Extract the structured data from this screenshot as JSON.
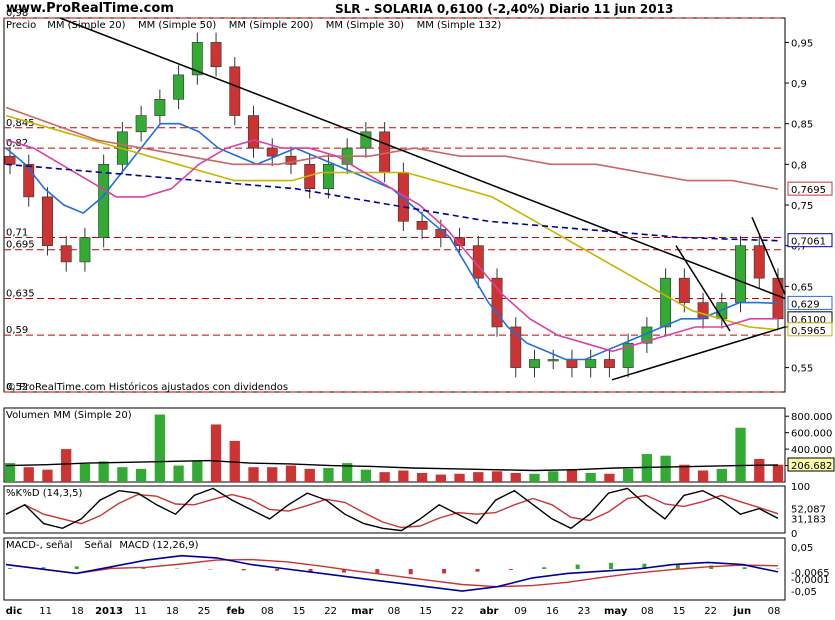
{
  "header": {
    "brand": "www.ProRealTime.com",
    "title": "SLR - SOLARIA    0,6100 (-2,40%)   Diario  11 jun 2013"
  },
  "colors": {
    "up": "#33aa33",
    "down": "#cc3333",
    "ma20": "#1f6fe0",
    "ma50": "#c8b400",
    "ma200": "#cc6666",
    "ma30": "#e040a0",
    "ma132": "#000099",
    "trend": "#000000",
    "hline": "#cc0000"
  },
  "price_panel": {
    "legend": [
      {
        "text": "Precio",
        "color": "#000000"
      },
      {
        "text": "MM (Simple 20)",
        "color": "#1f6fe0"
      },
      {
        "text": "MM (Simple 50)",
        "color": "#c8b400"
      },
      {
        "text": "MM (Simple 200)",
        "color": "#cc3333"
      },
      {
        "text": "MM (Simple 30)",
        "color": "#e040a0"
      },
      {
        "text": "MM (Simple 132)",
        "color": "#000099"
      }
    ],
    "footer": "© ProRealTime.com  Históricos ajustados con dividendos",
    "right_ticks": [
      "0,95",
      "0,9",
      "0,85",
      "0,8",
      "0,75",
      "0,7",
      "0,65",
      "0,6",
      "0,55"
    ],
    "right_badges": [
      {
        "text": "0,7695",
        "value": 0.7695,
        "color": "#cc3333"
      },
      {
        "text": "0,7061",
        "value": 0.7061,
        "color": "#000099"
      },
      {
        "text": "0,629",
        "value": 0.629,
        "color": "#1f6fe0"
      },
      {
        "text": "0,6100",
        "value": 0.61,
        "color": "#000000"
      },
      {
        "text": "0,5965",
        "value": 0.5965,
        "color": "#c8b400"
      }
    ],
    "hlines": [
      {
        "text": "0,98",
        "value": 0.98
      },
      {
        "text": "0,845",
        "value": 0.845
      },
      {
        "text": "0,82",
        "value": 0.82
      },
      {
        "text": "0,71",
        "value": 0.71
      },
      {
        "text": "0,695",
        "value": 0.695
      },
      {
        "text": "0,635",
        "value": 0.635
      },
      {
        "text": "0,59",
        "value": 0.59
      },
      {
        "text": "0,52",
        "value": 0.52
      }
    ]
  },
  "volume_panel": {
    "legend": [
      {
        "text": "Volumen",
        "color": "#cc3333"
      },
      {
        "text": "MM (Simple 20)",
        "color": "#000000"
      }
    ],
    "right_ticks": [
      "800.000",
      "600.000",
      "400.000",
      "200.000"
    ],
    "badge": "206.682"
  },
  "stoch_panel": {
    "legend": [
      {
        "text": "%K",
        "color": "#000000"
      },
      {
        "text": "%D (14,3,5)",
        "color": "#cc3333"
      }
    ],
    "right_ticks": [
      "100",
      "0"
    ],
    "badges": [
      "52,087",
      "31,183"
    ]
  },
  "macd_panel": {
    "legend": [
      {
        "text": "MACD-, señal",
        "color": "#cc3333"
      },
      {
        "text": "Señal",
        "color": "#cc3333"
      },
      {
        "text": "MACD (12,26,9)",
        "color": "#000099"
      }
    ],
    "right_ticks": [
      "0,05",
      "-0,05"
    ],
    "badges": [
      "-0,0065",
      "-0,0001"
    ]
  },
  "x_axis": [
    "dic",
    "11",
    "18",
    "2013",
    "11",
    "18",
    "25",
    "feb",
    "08",
    "15",
    "22",
    "mar",
    "08",
    "15",
    "22",
    "abr",
    "09",
    "16",
    "23",
    "may",
    "08",
    "15",
    "22",
    "jun",
    "08"
  ],
  "chart_data": {
    "type": "candlestick",
    "title": "SLR - SOLARIA 0,6100 (-2,40%) Diario 11 jun 2013",
    "ylabel": "",
    "ylim": [
      0.52,
      0.98
    ],
    "x_range": [
      "dic 2012",
      "11 jun 2013"
    ],
    "series": [
      {
        "name": "Precio",
        "close": [
          0.8,
          0.76,
          0.7,
          0.68,
          0.71,
          0.8,
          0.84,
          0.86,
          0.88,
          0.91,
          0.95,
          0.92,
          0.86,
          0.82,
          0.81,
          0.8,
          0.77,
          0.8,
          0.82,
          0.84,
          0.79,
          0.73,
          0.72,
          0.71,
          0.7,
          0.66,
          0.6,
          0.55,
          0.56,
          0.56,
          0.55,
          0.56,
          0.55,
          0.58,
          0.6,
          0.66,
          0.63,
          0.61,
          0.63,
          0.7,
          0.66,
          0.61
        ]
      },
      {
        "name": "MM (Simple 20)",
        "values": [
          0.82,
          0.8,
          0.77,
          0.75,
          0.74,
          0.76,
          0.79,
          0.82,
          0.85,
          0.85,
          0.84,
          0.82,
          0.81,
          0.8,
          0.81,
          0.82,
          0.81,
          0.8,
          0.79,
          0.78,
          0.77,
          0.75,
          0.73,
          0.71,
          0.67,
          0.63,
          0.6,
          0.58,
          0.57,
          0.56,
          0.56,
          0.57,
          0.58,
          0.59,
          0.6,
          0.61,
          0.61,
          0.62,
          0.63,
          0.63,
          0.629
        ]
      },
      {
        "name": "MM (Simple 50)",
        "values": [
          0.86,
          0.85,
          0.84,
          0.83,
          0.82,
          0.81,
          0.8,
          0.79,
          0.78,
          0.78,
          0.78,
          0.79,
          0.79,
          0.79,
          0.79,
          0.78,
          0.77,
          0.76,
          0.74,
          0.72,
          0.7,
          0.68,
          0.66,
          0.64,
          0.62,
          0.61,
          0.6,
          0.5965
        ]
      },
      {
        "name": "MM (Simple 200)",
        "values": [
          0.87,
          0.85,
          0.83,
          0.82,
          0.81,
          0.8,
          0.8,
          0.81,
          0.81,
          0.82,
          0.81,
          0.81,
          0.8,
          0.8,
          0.79,
          0.78,
          0.78,
          0.7695
        ]
      },
      {
        "name": "MM (Simple 30)",
        "values": [
          0.83,
          0.82,
          0.8,
          0.78,
          0.76,
          0.76,
          0.77,
          0.8,
          0.82,
          0.83,
          0.82,
          0.82,
          0.81,
          0.79,
          0.77,
          0.75,
          0.72,
          0.68,
          0.64,
          0.61,
          0.59,
          0.58,
          0.57,
          0.58,
          0.59,
          0.6,
          0.6,
          0.61,
          0.61
        ]
      },
      {
        "name": "MM (Simple 132)",
        "values": [
          0.8,
          0.79,
          0.78,
          0.77,
          0.75,
          0.73,
          0.72,
          0.71,
          0.7061
        ]
      }
    ]
  }
}
